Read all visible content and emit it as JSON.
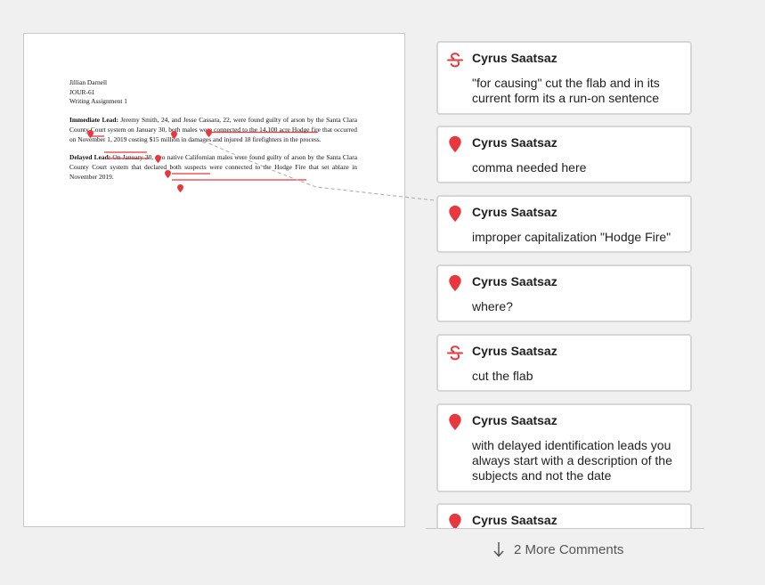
{
  "document": {
    "header_lines": [
      "Jillian Darnell",
      "JOUR-61",
      "Writing Assignment 1"
    ],
    "immediate_lead_label": "Immediate Lead:",
    "immediate_lead_text": "Jeremy Smith, 24, and Jesse Cassara, 22, were found guilty of arson by the Santa Clara County Court system on January 30, both males were connected to the 14,100 acre Hodge fire that occurred on November 1, 2019  costing $15 million in damages and injured 18 firefighters in the process.",
    "delayed_lead_label": "Delayed Lead:",
    "delayed_lead_text": "On January 30, two native Californian males were found guilty of arson by the Santa Clara County Court system that declared both suspects were connected to the Hodge Fire that set ablaze in November 2019."
  },
  "comments": [
    {
      "type": "strikethrough",
      "icon": "strikethrough-icon",
      "author": "Cyrus Saatsaz",
      "text": "\"for causing\" cut the flab and in its current form its a run-on sentence"
    },
    {
      "type": "pin",
      "icon": "pin-icon",
      "author": "Cyrus Saatsaz",
      "text": "comma needed here"
    },
    {
      "type": "pin",
      "icon": "pin-icon",
      "author": "Cyrus Saatsaz",
      "text": "improper capitalization \"Hodge Fire\""
    },
    {
      "type": "pin",
      "icon": "pin-icon",
      "author": "Cyrus Saatsaz",
      "text": "where?"
    },
    {
      "type": "strikethrough",
      "icon": "strikethrough-icon",
      "author": "Cyrus Saatsaz",
      "text": "cut the flab"
    },
    {
      "type": "pin",
      "icon": "pin-icon",
      "author": "Cyrus Saatsaz",
      "text": "with delayed identification leads you always start with a description of the subjects and not the date"
    },
    {
      "type": "pin",
      "icon": "pin-icon",
      "author": "Cyrus Saatsaz",
      "text": ""
    }
  ],
  "more_comments": {
    "label": "2 More Comments",
    "icon": "arrow-down-icon"
  },
  "colors": {
    "accent_red": "#e8383d",
    "card_border": "#d6d6d6",
    "background": "#f0f0f0"
  }
}
